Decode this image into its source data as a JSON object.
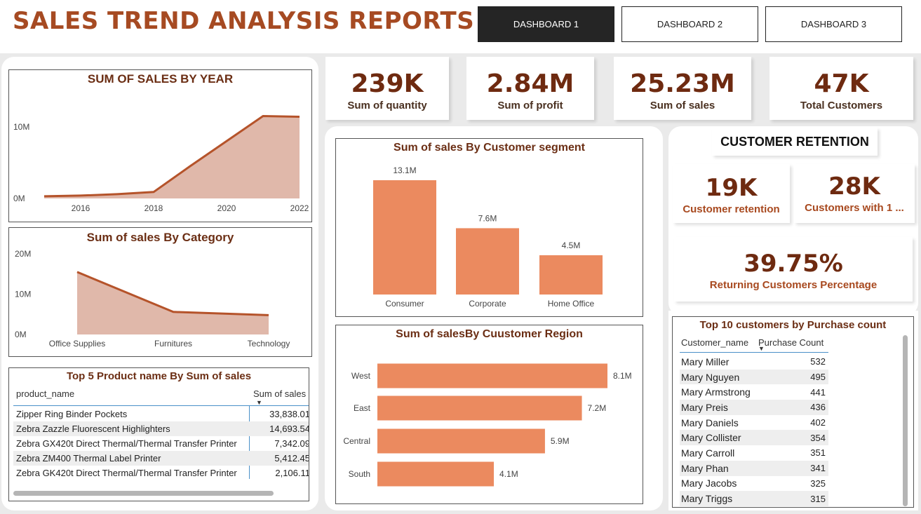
{
  "title": "SALES TREND ANALYSIS REPORTS",
  "nav": [
    "DASHBOARD 1",
    "DASHBOARD 2",
    "DASHBOARD 3"
  ],
  "kpis": [
    {
      "value": "239K",
      "label": "Sum of quantity"
    },
    {
      "value": "2.84M",
      "label": "Sum of profit"
    },
    {
      "value": "25.23M",
      "label": "Sum of sales"
    },
    {
      "value": "47K",
      "label": "Total Customers"
    }
  ],
  "retention": {
    "title": "CUSTOMER RETENTION",
    "cards": [
      {
        "value": "19K",
        "label": "Customer retention"
      },
      {
        "value": "28K",
        "label": "Customers with  1 ..."
      }
    ],
    "pct_value": "39.75%",
    "pct_label": "Returning Customers Percentage"
  },
  "top_products": {
    "title": "Top 5 Product name By Sum of sales",
    "columns": [
      "product_name",
      "Sum of sales"
    ],
    "rows": [
      [
        "Zipper Ring Binder Pockets",
        "33,838.01"
      ],
      [
        "Zebra Zazzle Fluorescent Highlighters",
        "14,693.54"
      ],
      [
        "Zebra GX420t Direct Thermal/Thermal Transfer Printer",
        "7,342.09"
      ],
      [
        "Zebra ZM400 Thermal Label Printer",
        "5,412.45"
      ],
      [
        "Zebra GK420t Direct Thermal/Thermal Transfer Printer",
        "2,106.11"
      ]
    ]
  },
  "top_customers": {
    "title": "Top 10 customers by Purchase count",
    "columns": [
      "Customer_name",
      "Purchase Count"
    ],
    "rows": [
      [
        "Mary Miller",
        "532"
      ],
      [
        "Mary Nguyen",
        "495"
      ],
      [
        "Mary Armstrong",
        "441"
      ],
      [
        "Mary Preis",
        "436"
      ],
      [
        "Mary Daniels",
        "402"
      ],
      [
        "Mary Collister",
        "354"
      ],
      [
        "Mary Carroll",
        "351"
      ],
      [
        "Mary Phan",
        "341"
      ],
      [
        "Mary Jacobs",
        "325"
      ],
      [
        "Mary Triggs",
        "315"
      ]
    ]
  },
  "chart_data": [
    {
      "type": "area",
      "title": "SUM OF SALES BY YEAR",
      "x": [
        2015,
        2016,
        2017,
        2018,
        2019,
        2020,
        2021,
        2022
      ],
      "values": [
        0.3,
        0.4,
        0.6,
        0.9,
        4.5,
        8.0,
        11.5,
        11.4
      ],
      "xticks": [
        "2016",
        "2018",
        "2020",
        "2022"
      ],
      "yticks": [
        "0M",
        "10M"
      ],
      "ylim": [
        0,
        14
      ],
      "color": "#b5532a",
      "fill": "#e0b8aa"
    },
    {
      "type": "area",
      "title": "Sum of sales By Category",
      "categories": [
        "Office Supplies",
        "Furnitures",
        "Technology"
      ],
      "values": [
        15.5,
        5.6,
        4.8
      ],
      "yticks": [
        "0M",
        "10M",
        "20M"
      ],
      "ylim": [
        0,
        20
      ],
      "color": "#b5532a",
      "fill": "#e0b8aa"
    },
    {
      "type": "bar",
      "title": "Sum of sales By Customer segment",
      "categories": [
        "Consumer",
        "Corporate",
        "Home Office"
      ],
      "values": [
        13.1,
        7.6,
        4.5
      ],
      "labels": [
        "13.1M",
        "7.6M",
        "4.5M"
      ],
      "color": "#eb8a5f"
    },
    {
      "type": "bar",
      "orientation": "horizontal",
      "title": "Sum of salesBy Cuustomer Region",
      "categories": [
        "West",
        "East",
        "Central",
        "South"
      ],
      "values": [
        8.1,
        7.2,
        5.9,
        4.1
      ],
      "labels": [
        "8.1M",
        "7.2M",
        "5.9M",
        "4.1M"
      ],
      "color": "#eb8a5f"
    }
  ]
}
